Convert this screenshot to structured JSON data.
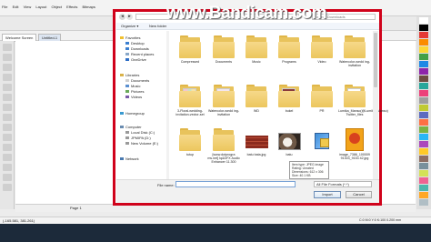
{
  "watermark": "www.Bandicam.com",
  "app": {
    "menu": [
      "File",
      "Edit",
      "View",
      "Layout",
      "Object",
      "Effects",
      "Bitmaps"
    ],
    "tabs": [
      "Welcome Screen",
      "Untitled-1"
    ],
    "page_label": "Page 1",
    "status_left": "(-165.581, 381.261)",
    "status_right": "C:0 M:0 Y:0 K:100  0.200 mm",
    "swatches": [
      "#ffffff",
      "#000000",
      "#e53935",
      "#fb8c00",
      "#fdd835",
      "#43a047",
      "#1e88e5",
      "#8e24aa",
      "#6d4c41",
      "#26a69a",
      "#ec407a",
      "#9e9e9e",
      "#c0ca33",
      "#5c6bc0",
      "#ff7043",
      "#7cb342",
      "#29b6f6",
      "#ab47bc",
      "#ffca28",
      "#8d6e63",
      "#78909c",
      "#d4e157",
      "#f06292",
      "#4db6ac",
      "#ffa726",
      "#b0bec5"
    ]
  },
  "dialog": {
    "address": "",
    "search_placeholder": "Search Downloads",
    "organize_label": "Organize ▾",
    "newfolder_label": "New folder",
    "nav": {
      "favorites": "Favorites",
      "desktop": "Desktop",
      "downloads": "Downloads",
      "recent": "Recent places",
      "onedrive": "OneDrive",
      "libraries": "Libraries",
      "documents": "Documents",
      "music": "Music",
      "pictures": "Pictures",
      "videos": "Videos",
      "homegroup": "Homegroup",
      "computer": "Computer",
      "local_disk": "Local Disk (C:)",
      "jpmipa": "JPMIPA (D:)",
      "new_volume": "New Volume (E:)",
      "network": "Network"
    },
    "files": [
      {
        "label": "Compressed",
        "kind": "folder"
      },
      {
        "label": "Documents",
        "kind": "folder"
      },
      {
        "label": "Music",
        "kind": "folder"
      },
      {
        "label": "Programs",
        "kind": "folder"
      },
      {
        "label": "Video",
        "kind": "folder"
      },
      {
        "label": "Watercolor-wedd ing-invitation",
        "kind": "folder"
      },
      {
        "label": "3-Floral-wedding-invitation-vector-set",
        "kind": "folder-img1"
      },
      {
        "label": "Watercolor-wedd ing-invitation",
        "kind": "folder-img2"
      },
      {
        "label": "WD",
        "kind": "folder"
      },
      {
        "label": "bukel",
        "kind": "folder-img3"
      },
      {
        "label": "PR",
        "kind": "folder"
      },
      {
        "label": "Lumika_Manso(@Lumika_Manso) Twitter_files",
        "kind": "folder-doc"
      },
      {
        "label": "tutup",
        "kind": "folder"
      },
      {
        "label": "[www.dotprogra ms.net] Iq&DFX Audio Enhancer 11.300",
        "kind": "folder"
      },
      {
        "label": "batu bata.jpg",
        "kind": "image-brick"
      },
      {
        "label": "batu",
        "kind": "image-cat"
      },
      {
        "label": "",
        "kind": "installer"
      },
      {
        "label": "image_7386_100009 91303_9153 42.jpg",
        "kind": "image-poster"
      }
    ],
    "tooltip": {
      "type": "Item type: JPEG image",
      "rating": "Rating: Unrated",
      "dimensions": "Dimensions: 612 x 306",
      "size": "Size: 40.1 KB"
    },
    "filename_label": "File name:",
    "filename_value": "",
    "filetype_value": "All File Formats (*.*)",
    "import_label": "Import",
    "cancel_label": "Cancel"
  },
  "colors": {
    "capture_frame": "#d0021b",
    "folder": "#ecc65d"
  }
}
